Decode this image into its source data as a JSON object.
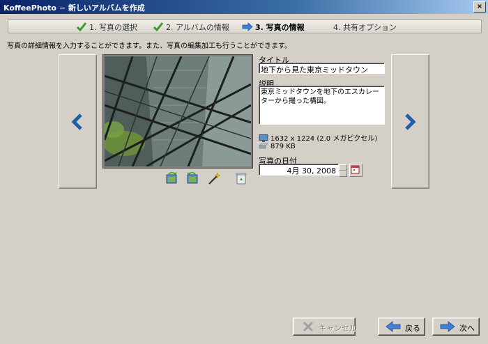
{
  "window": {
    "title": "KoffeePhoto − 新しいアルバムを作成",
    "close": "×"
  },
  "steps": [
    {
      "label": "1. 写真の選択",
      "status": "done"
    },
    {
      "label": "2. アルバムの情報",
      "status": "done"
    },
    {
      "label": "3. 写真の情報",
      "status": "current"
    },
    {
      "label": "4. 共有オプション",
      "status": "pending"
    }
  ],
  "description": "写真の詳細情報を入力することができます。また、写真の編集加工も行うことができます。",
  "photo_form": {
    "title_label": "タイトル",
    "title_value": "地下から見た東京ミッドタウン",
    "desc_label": "説明",
    "desc_value": "東京ミッドタウンを地下のエスカレーターから撮った構図。",
    "dimensions": "1632 x 1224 (2.0 メガピクセル)",
    "filesize": "879 KB",
    "date_label": "写真の日付",
    "date_value": "4月 30, 2008"
  },
  "buttons": {
    "cancel": "キャンセル",
    "back": "戻る",
    "next": "次へ"
  },
  "colors": {
    "accent_arrow": "#2e6fb5",
    "check": "#3a9a2a"
  }
}
